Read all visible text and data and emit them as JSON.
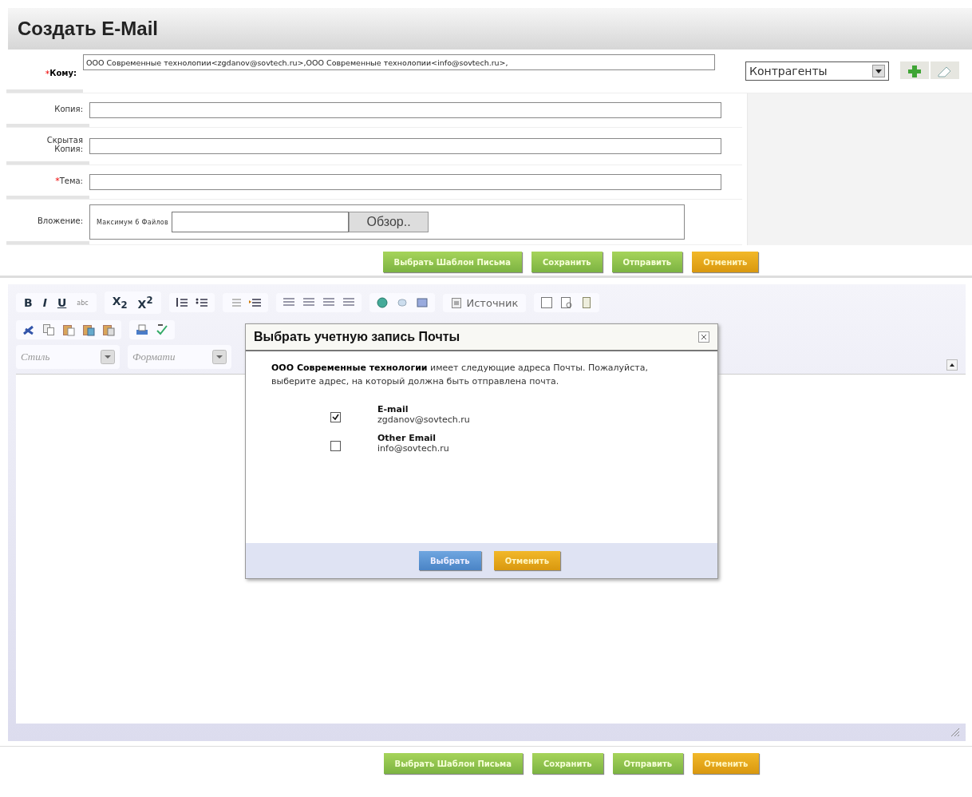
{
  "title": "Создать E-Mail",
  "fields": [
    {
      "kind": "text",
      "required_mark": "*",
      "label": "Кому:",
      "value": "ООО Современные технолопии<zgdanov@sovtech.ru>,ООО Современные технолопии<info@sovtech.ru>,"
    },
    {
      "kind": "text",
      "label": "Копия:"
    },
    {
      "kind": "text",
      "label": "Скрытая Копия:"
    },
    {
      "kind": "text",
      "required_mark": "*",
      "label": "Тема:"
    },
    {
      "kind": "file",
      "label": "Вложение:",
      "hint": "Максимум 6 Файлов",
      "browse": "Обзор.."
    }
  ],
  "recipient_source": {
    "value": "Контрагенты"
  },
  "actions": [
    {
      "label": "Выбрать Шаблон Письма",
      "kind": "green"
    },
    {
      "label": "Сохранить",
      "kind": "green"
    },
    {
      "label": "Отправить",
      "kind": "green"
    },
    {
      "label": "Отменить",
      "kind": "orange"
    }
  ],
  "editor": {
    "format_buttons": [
      "B",
      "I",
      "U",
      "abc",
      "X$_{2}$",
      "X$^{2}$"
    ],
    "source_button": "Источник",
    "style_combo": "Стиль",
    "format_combo": "Формати"
  },
  "dialog": {
    "title": "Выбрать учетную запись Почты",
    "message": "**ООО Современные технологии** имеет следующие адреса Почты. Пожалуйста, выберите адрес, на который должна быть отправлена почта.",
    "options": [
      {
        "label": "E-mail",
        "address": "zgdanov@sovtech.ru",
        "checked": true
      },
      {
        "label": "Other Email",
        "address": "info@sovtech.ru",
        "checked": false
      }
    ],
    "buttons": [
      {
        "label": "Выбрать",
        "kind": "blue"
      },
      {
        "label": "Отменить",
        "kind": "orange"
      }
    ]
  },
  "bottom_actions": [
    {
      "label": "Выбрать Шаблон Письма",
      "kind": "green"
    },
    {
      "label": "Сохранить",
      "kind": "green"
    },
    {
      "label": "Отправить",
      "kind": "green"
    },
    {
      "label": "Отменить",
      "kind": "orange"
    }
  ]
}
